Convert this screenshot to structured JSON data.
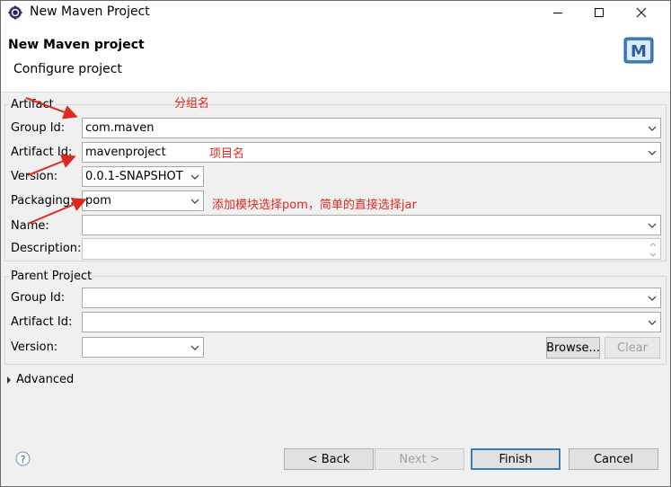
{
  "window": {
    "title": "New Maven Project"
  },
  "header": {
    "title": "New Maven project",
    "subtitle": "Configure project"
  },
  "artifact_group": {
    "legend": "Artifact",
    "group_id": {
      "label": "Group Id:",
      "value": "com.maven"
    },
    "artifact_id": {
      "label": "Artifact Id:",
      "value": "mavenproject"
    },
    "version": {
      "label": "Version:",
      "value": "0.0.1-SNAPSHOT"
    },
    "packaging": {
      "label": "Packaging:",
      "value": "pom"
    },
    "name": {
      "label": "Name:",
      "value": ""
    },
    "description": {
      "label": "Description:",
      "value": ""
    }
  },
  "parent_group": {
    "legend": "Parent Project",
    "group_id": {
      "label": "Group Id:",
      "value": ""
    },
    "artifact_id": {
      "label": "Artifact Id:",
      "value": ""
    },
    "version": {
      "label": "Version:",
      "value": ""
    },
    "browse_label": "Browse...",
    "clear_label": "Clear"
  },
  "advanced": {
    "label": "Advanced"
  },
  "annotations": {
    "group_note": "分组名",
    "artifact_note": "项目名",
    "packaging_note": "添加模块选择pom，简单的直接选择jar"
  },
  "footer": {
    "back_label": "< Back",
    "next_label": "Next >",
    "finish_label": "Finish",
    "cancel_label": "Cancel"
  },
  "icons": {
    "app": "eclipse-icon",
    "logo": "maven-logo-icon",
    "help": "help-icon"
  },
  "colors": {
    "annotation": "#e0271f",
    "default_button_border": "#3c7fb1"
  }
}
